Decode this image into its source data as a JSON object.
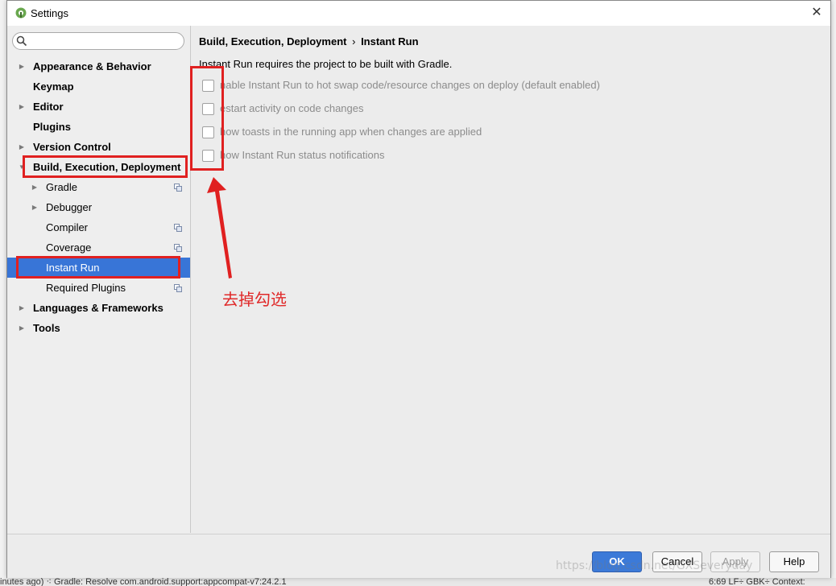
{
  "window": {
    "title": "Settings"
  },
  "sidebar": {
    "search_placeholder": "",
    "items": [
      {
        "label": "Appearance & Behavior",
        "bold": true,
        "expandable": true
      },
      {
        "label": "Keymap",
        "bold": true,
        "expandable": false
      },
      {
        "label": "Editor",
        "bold": true,
        "expandable": true
      },
      {
        "label": "Plugins",
        "bold": true,
        "expandable": false
      },
      {
        "label": "Version Control",
        "bold": true,
        "expandable": true
      },
      {
        "label": "Build, Execution, Deployment",
        "bold": true,
        "expanded": true
      },
      {
        "label": "Gradle",
        "expandable": true,
        "project_icon": true
      },
      {
        "label": "Debugger",
        "expandable": true
      },
      {
        "label": "Compiler",
        "project_icon": true
      },
      {
        "label": "Coverage",
        "project_icon": true
      },
      {
        "label": "Instant Run",
        "selected": true
      },
      {
        "label": "Required Plugins",
        "project_icon": true
      },
      {
        "label": "Languages & Frameworks",
        "bold": true,
        "expandable": true
      },
      {
        "label": "Tools",
        "bold": true,
        "expandable": true
      }
    ]
  },
  "panel": {
    "breadcrumb_parent": "Build, Execution, Deployment",
    "breadcrumb_sep": "›",
    "breadcrumb_current": "Instant Run",
    "description": "Instant Run requires the project to be built with Gradle.",
    "options": [
      {
        "label": "nable Instant Run to hot swap code/resource changes on deploy (default enabled)",
        "checked": false
      },
      {
        "label": "estart activity on code changes",
        "checked": false
      },
      {
        "label": "how toasts in the running app when changes are applied",
        "checked": false
      },
      {
        "label": "how Instant Run status notifications",
        "checked": false
      }
    ]
  },
  "footer": {
    "ok": "OK",
    "cancel": "Cancel",
    "apply": "Apply",
    "help": "Help"
  },
  "annotation": {
    "text": "去掉勾选",
    "color": "#e02020"
  },
  "watermark": "https://blog.csdn.net/GXSeveryday",
  "background_ide": {
    "status_text": "inutes ago) ⁖ Gradle: Resolve com.android.support:appcompat-v7:24.2.1",
    "status_right": "6:69  LF÷  GBK÷  Context:"
  },
  "colors": {
    "selection": "#3875d7",
    "ok_button": "#3c7ad8",
    "annotation": "#e02020"
  }
}
